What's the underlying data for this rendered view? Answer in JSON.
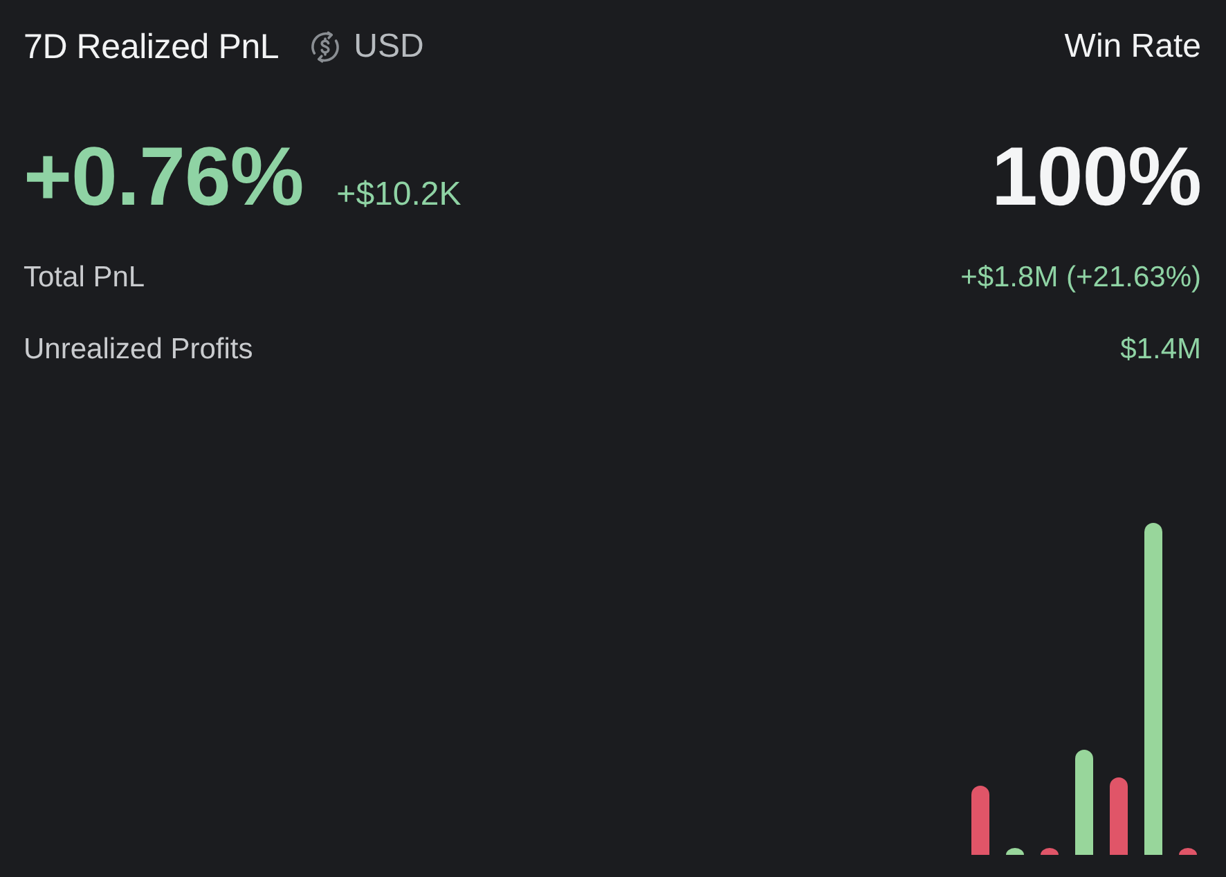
{
  "header": {
    "title": "7D Realized PnL",
    "currency": "USD",
    "win_rate_label": "Win Rate"
  },
  "realized": {
    "percent": "+0.76%",
    "amount": "+$10.2K"
  },
  "win_rate": {
    "value": "100%"
  },
  "rows": [
    {
      "label": "Total PnL",
      "value": "+$1.8M (+21.63%)"
    },
    {
      "label": "Unrealized Profits",
      "value": "$1.4M"
    }
  ]
}
